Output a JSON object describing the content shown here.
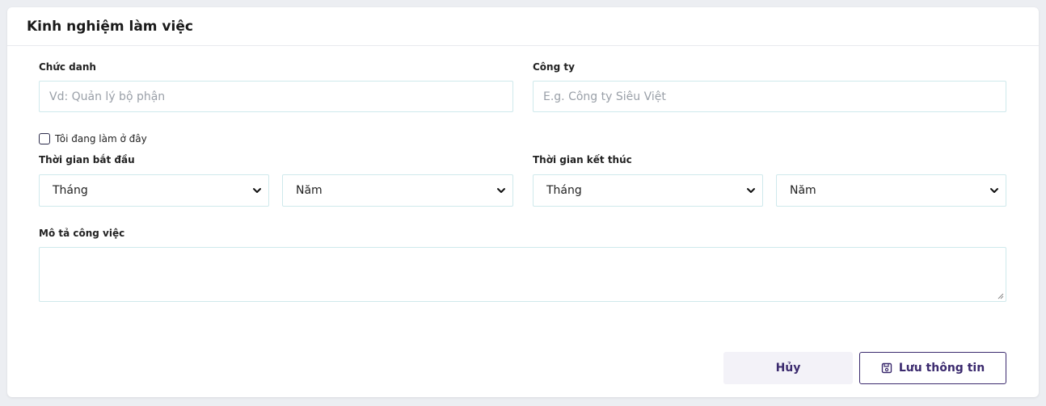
{
  "card": {
    "title": "Kinh nghiệm làm việc"
  },
  "form": {
    "job_title": {
      "label": "Chức danh",
      "placeholder": "Vd: Quản lý bộ phận"
    },
    "company": {
      "label": "Công ty",
      "placeholder": "E.g. Công ty Siêu Việt"
    },
    "currently_working": {
      "label": "Tôi đang làm ở đây",
      "checked": false
    },
    "start_time": {
      "label": "Thời gian bắt đầu",
      "month": "Tháng",
      "year": "Năm"
    },
    "end_time": {
      "label": "Thời gian kết thúc",
      "month": "Tháng",
      "year": "Năm"
    },
    "description": {
      "label": "Mô tả công việc",
      "value": ""
    }
  },
  "actions": {
    "cancel_label": "Hủy",
    "save_label": "Lưu thông tin"
  },
  "icons": {
    "select_arrow": "chevron-down-icon",
    "save": "save-icon",
    "resize": "resize-grip-icon"
  },
  "colors": {
    "accent": "#3b2a6e",
    "input_border": "#cfe9ec",
    "cancel_bg": "#f3f2f8"
  }
}
